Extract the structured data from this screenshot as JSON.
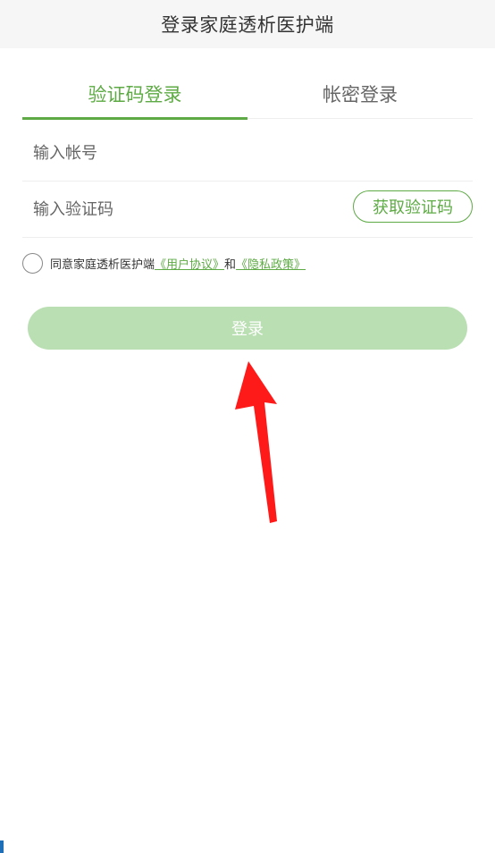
{
  "header": {
    "title": "登录家庭透析医护端"
  },
  "tabs": [
    {
      "label": "验证码登录",
      "active": true
    },
    {
      "label": "帐密登录",
      "active": false
    }
  ],
  "form": {
    "account_placeholder": "输入帐号",
    "account_value": "",
    "code_placeholder": "输入验证码",
    "code_value": "",
    "get_code_label": "获取验证码"
  },
  "agreement": {
    "prefix": "同意家庭透析医护端",
    "user_agreement": "《用户协议》",
    "and": "和",
    "privacy_policy": "《隐私政策》",
    "checked": false
  },
  "login_button": {
    "label": "登录"
  },
  "colors": {
    "accent": "#5eaa45",
    "login_disabled": "#badfb3",
    "annotation_arrow": "#ff1a1a"
  },
  "icons": [
    "checkbox-circle-icon",
    "annotation-arrow-icon"
  ]
}
